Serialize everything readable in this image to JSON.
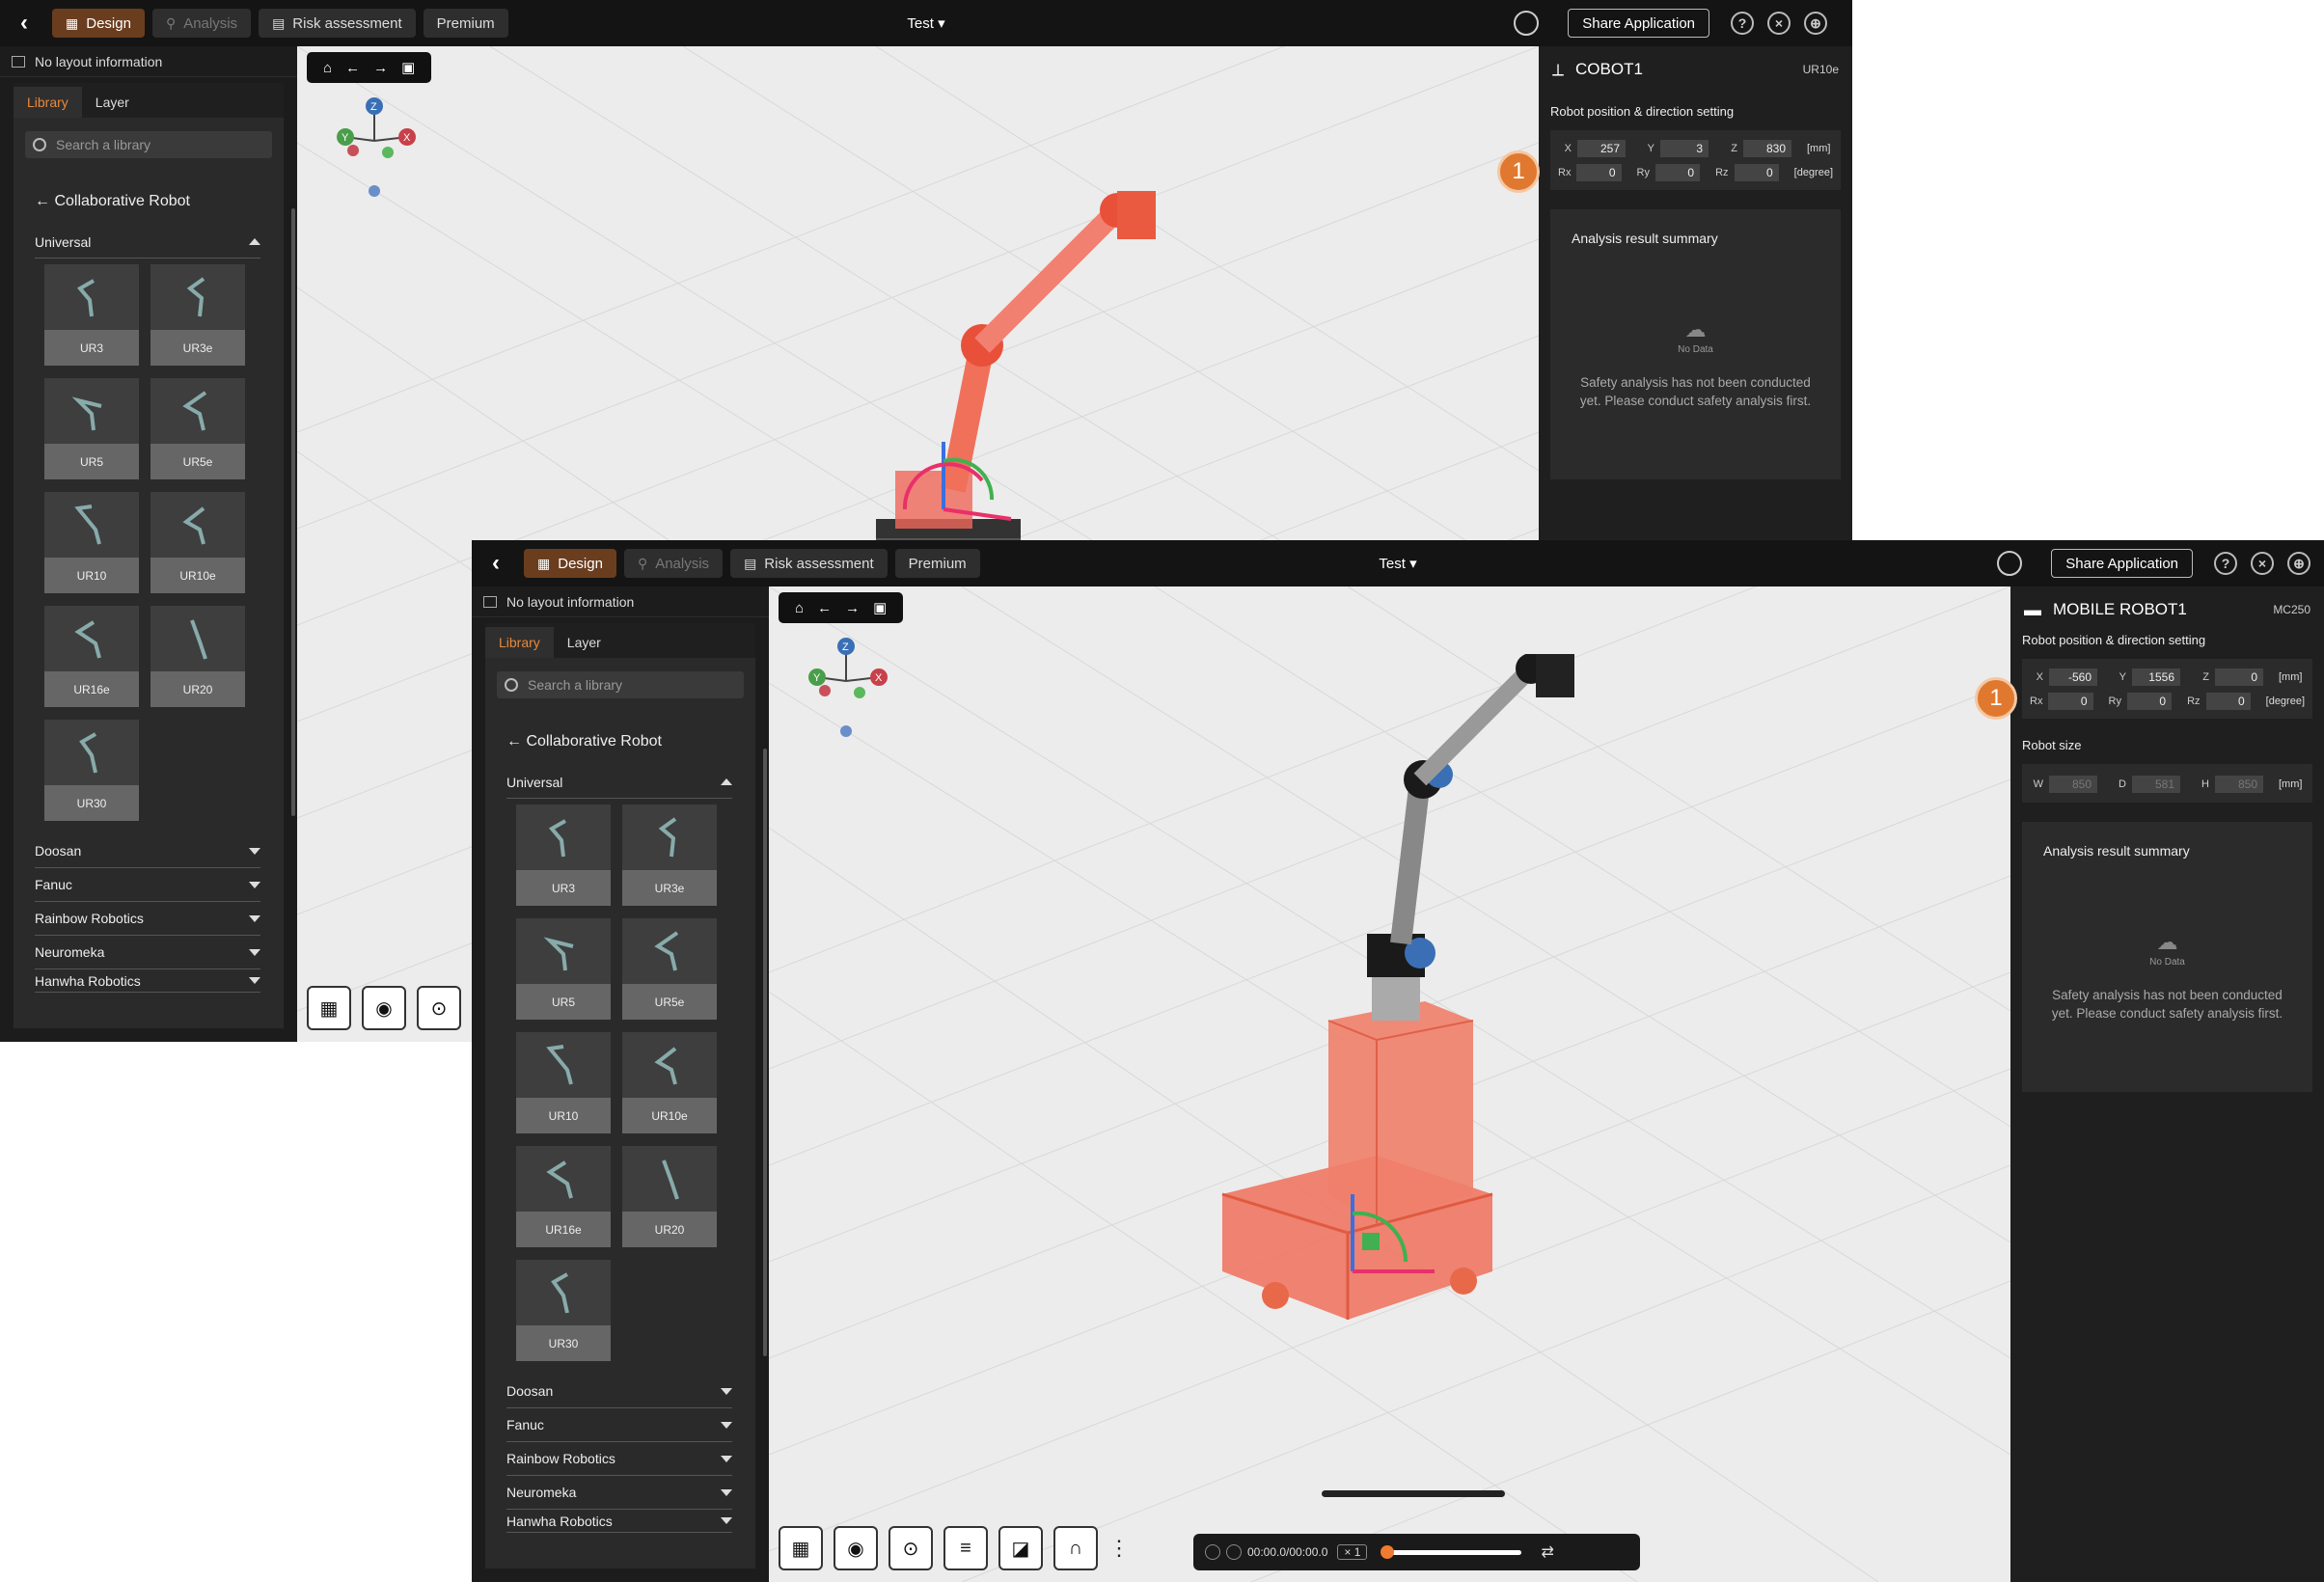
{
  "header": {
    "tabs": {
      "design": "Design",
      "analysis": "Analysis",
      "risk": "Risk assessment",
      "premium": "Premium"
    },
    "project_title": "Test",
    "share_label": "Share Application"
  },
  "left_panel": {
    "no_layout": "No layout information",
    "tab_library": "Library",
    "tab_layer": "Layer",
    "search_placeholder": "Search a library",
    "breadcrumb": "Collaborative Robot",
    "brand_open": "Universal",
    "robots": [
      "UR3",
      "UR3e",
      "UR5",
      "UR5e",
      "UR10",
      "UR10e",
      "UR16e",
      "UR20",
      "UR30"
    ],
    "brands": [
      "Doosan",
      "Fanuc",
      "Rainbow Robotics",
      "Neuromeka",
      "Hanwha Robotics"
    ]
  },
  "window_a": {
    "object_name": "COBOT1",
    "object_model": "UR10e",
    "section_position": "Robot position & direction setting",
    "x": "257",
    "y": "3",
    "z": "830",
    "rx": "0",
    "ry": "0",
    "rz": "0",
    "unit_mm": "[mm]",
    "unit_deg": "[degree]",
    "summary_title": "Analysis result summary",
    "no_data": "No Data",
    "summary_msg": "Safety analysis has not been conducted yet. Please conduct safety analysis first.",
    "badge": "1"
  },
  "window_b": {
    "object_name": "MOBILE ROBOT1",
    "object_model": "MC250",
    "section_position": "Robot position & direction setting",
    "x": "-560",
    "y": "1556",
    "z": "0",
    "rx": "0",
    "ry": "0",
    "rz": "0",
    "unit_mm": "[mm]",
    "unit_deg": "[degree]",
    "section_size": "Robot size",
    "w": "850",
    "d": "581",
    "h": "850",
    "summary_title": "Analysis result summary",
    "no_data": "No Data",
    "summary_msg": "Safety analysis has not been conducted yet. Please conduct safety analysis first.",
    "badge": "1",
    "player_time": "00:00.0/00:00.0",
    "player_speed": "× 1"
  },
  "colors": {
    "accent": "#f07a30",
    "robot_highlight": "#f0684a",
    "viewport_bg": "#ececec"
  }
}
